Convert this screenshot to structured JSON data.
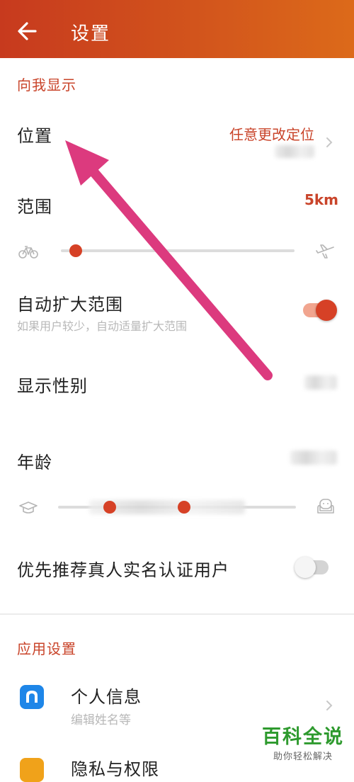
{
  "header": {
    "title": "设置"
  },
  "show_to_me": {
    "section_title": "向我显示",
    "location": {
      "label": "位置",
      "value": "任意更改定位"
    },
    "range": {
      "label": "范围",
      "value": "5km",
      "slider_fraction": 0.04
    },
    "auto_expand": {
      "label": "自动扩大范围",
      "description": "如果用户较少，自动适量扩大范围",
      "enabled": true
    },
    "show_gender": {
      "label": "显示性别"
    },
    "age": {
      "label": "年龄",
      "range_fraction": [
        0.2,
        0.53
      ]
    },
    "prefer_verified": {
      "label": "优先推荐真人实名认证用户",
      "enabled": false
    }
  },
  "app_settings": {
    "section_title": "应用设置",
    "personal_info": {
      "title": "个人信息",
      "subtitle": "编辑姓名等"
    },
    "privacy": {
      "title": "隐私与权限"
    }
  },
  "watermark": {
    "main": "百科全说",
    "sub": "助你轻松解决"
  },
  "colors": {
    "accent": "#c9442a",
    "header_start": "#c73a1e",
    "header_end": "#dc6a1a",
    "toggle_on": "#d64126",
    "watermark": "#2e9a2e"
  }
}
